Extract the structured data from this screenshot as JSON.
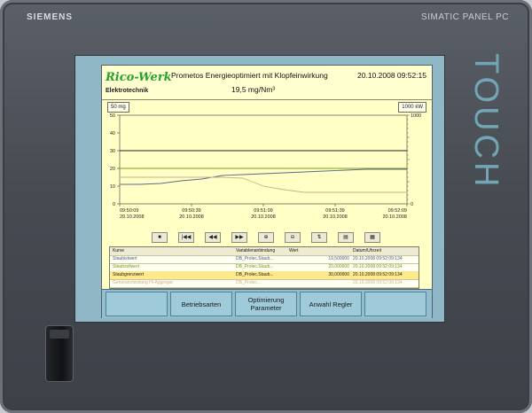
{
  "panel": {
    "brand": "SIEMENS",
    "model": "SIMATIC PANEL PC",
    "touch_label": "TOUCH"
  },
  "header": {
    "logo": "Rico-Werk",
    "logo_sub": "Elektrotechnik",
    "title": "Prometos Energieoptimiert mit Klopfeinwirkung",
    "datetime": "20.10.2008 09:52:15",
    "value": "19,5 mg/Nm³"
  },
  "chart_data": {
    "type": "line",
    "left_axis": {
      "unit": "mg",
      "range": [
        0,
        50
      ],
      "ticks": [
        "50",
        "40",
        "30",
        "20",
        "10",
        "0"
      ],
      "scale_box": "50"
    },
    "right_axis": {
      "unit": "kW",
      "range": [
        0,
        1000
      ],
      "ticks": [
        "1000",
        "0"
      ],
      "scale_box": "1000"
    },
    "x_ticks": [
      {
        "time": "09:50:09",
        "date": "20.10.2008"
      },
      {
        "time": "09:50:39",
        "date": "20.10.2008"
      },
      {
        "time": "09:51:09",
        "date": "20.10.2008"
      },
      {
        "time": "09:51:39",
        "date": "20.10.2008"
      },
      {
        "time": "09:52:09",
        "date": "20.10.2008"
      }
    ],
    "series": [
      {
        "name": "Staubistwert",
        "color": "#5b6a8a",
        "values": [
          11,
          11,
          11.5,
          13,
          14,
          16,
          16.5,
          17,
          17.5,
          18,
          18.5,
          19,
          19.5,
          19.5,
          19.5
        ]
      },
      {
        "name": "Staubsollwert",
        "color": "#7aa21e",
        "values": [
          20,
          20,
          20,
          20,
          20,
          20,
          20,
          20,
          20,
          20,
          20,
          20,
          20,
          20,
          20
        ]
      },
      {
        "name": "Staubgrenzwert",
        "color": "#222222",
        "values": [
          30,
          30,
          30,
          30,
          30,
          30,
          30,
          30,
          30,
          30,
          30,
          30,
          30,
          30,
          30
        ]
      },
      {
        "name": "Leistung",
        "color": "#c9b28a",
        "values": [
          15,
          15,
          15,
          15,
          15,
          15,
          14.5,
          10,
          8,
          6.5,
          6.5,
          6.5,
          6.5,
          6.5,
          6.5
        ]
      }
    ]
  },
  "controls": [
    {
      "name": "stop-button",
      "glyph": "■"
    },
    {
      "name": "first-button",
      "glyph": "|◀◀"
    },
    {
      "name": "rewind-button",
      "glyph": "◀◀"
    },
    {
      "name": "forward-button",
      "glyph": "▶▶"
    },
    {
      "name": "zoom-in-button",
      "glyph": "⊕"
    },
    {
      "name": "zoom-out-button",
      "glyph": "⊖"
    },
    {
      "name": "ruler-button",
      "glyph": "⇅"
    },
    {
      "name": "export-button",
      "glyph": "▤"
    },
    {
      "name": "config-button",
      "glyph": "▦"
    }
  ],
  "table": {
    "headers": [
      "Kurve",
      "Variablenanbindung",
      "Wert",
      "Datum/Uhrzeit"
    ],
    "rows": [
      {
        "kurve": "Staubistwert",
        "variable": "DB_Prolec.Staub...",
        "wert": "19,500000",
        "datum": "20.10.2008 09:52:09:134",
        "color": "#4a5c86"
      },
      {
        "kurve": "Staubsollwert",
        "variable": "DB_Prolec.Staub...",
        "wert": "20,000000",
        "datum": "20.10.2008 09:52:09:134",
        "color": "#6f9a10"
      },
      {
        "kurve": "Staubgrenzwert",
        "variable": "DB_Prolec.Staub...",
        "wert": "30,000000",
        "datum": "20.10.2008 09:52:09:134",
        "color": "#222222"
      },
      {
        "kurve": "Generatorleistung Hi-Aggregat",
        "variable": "DB_Prolec...",
        "wert": "",
        "datum": "20.10.2008 09:52:09:134",
        "color": "#c9b28a"
      }
    ]
  },
  "buttons": [
    {
      "label": ""
    },
    {
      "label": "Betriebsarten"
    },
    {
      "label": "Optimierung Parameter"
    },
    {
      "label": "Anwahl Regler"
    },
    {
      "label": ""
    }
  ]
}
